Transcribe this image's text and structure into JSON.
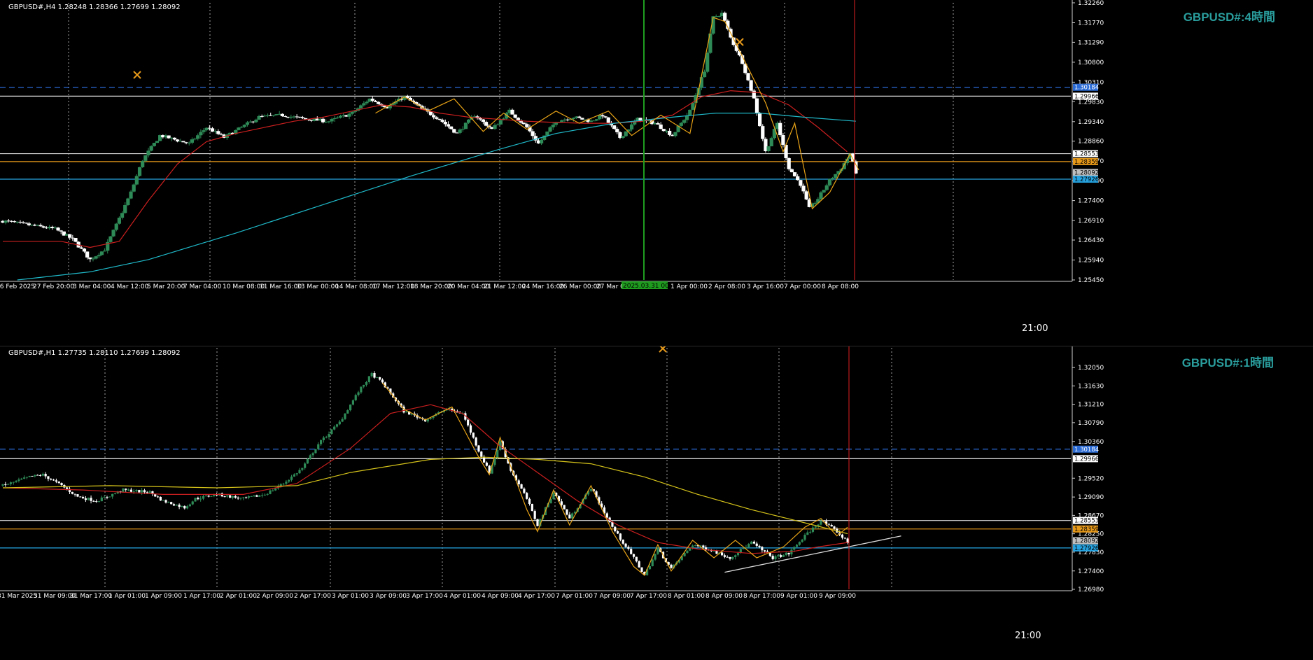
{
  "colors": {
    "background": "#000000",
    "grid": "#c8c8c8",
    "bull": "#2e8b57",
    "bear": "#ffffff",
    "ma_red": "#cc1f1f",
    "ma_cyan": "#1fb8c8",
    "ma_yellow": "#d4c21a",
    "zigzag": "#e8a317",
    "trend": "#dddddd",
    "level_blue_dash": "#2a6ad4",
    "level_white": "#e0e0e0",
    "level_orange": "#e89a1a",
    "level_cyan": "#26a3e0",
    "time_red": "#e02020",
    "vline_green": "#1f9d1f",
    "label_teal": "#2a9d9d"
  },
  "chart_data": [
    {
      "type": "candlestick",
      "symbol": "GBPUSD#,H4",
      "header": "GBPUSD#,H4  1.28248 1.28366 1.27699 1.28092",
      "ohlc": {
        "open": 1.28248,
        "high": 1.28366,
        "low": 1.27699,
        "close": 1.28092
      },
      "timeframe_label": "GBPUSD#:4時間",
      "ylim": [
        1.2545,
        1.3226
      ],
      "y_ticks": [
        "1.32260",
        "1.31770",
        "1.31290",
        "1.30800",
        "1.30310",
        "1.29830",
        "1.29340",
        "1.28860",
        "1.28370",
        "1.27890",
        "1.27400",
        "1.26910",
        "1.26430",
        "1.25940",
        "1.25450"
      ],
      "x_labels": [
        "26 Feb 2025",
        "27 Feb 20:00",
        "3 Mar 04:00",
        "4 Mar 12:00",
        "5 Mar 20:00",
        "7 Mar 04:00",
        "10 Mar 08:00",
        "11 Mar 16:00",
        "13 Mar 00:00",
        "14 Mar 08:00",
        "17 Mar 12:00",
        "18 Mar 20:00",
        "20 Mar 04:00",
        "21 Mar 12:00",
        "24 Mar 16:00",
        "26 Mar 00:00",
        "27 Mar 08:00",
        "2025.03.31 00:00",
        "1 Apr 00:00",
        "2 Apr 08:00",
        "3 Apr 16:00",
        "7 Apr 00:00",
        "8 Apr 08:00"
      ],
      "cursor_time": "21:00",
      "price_labels": [
        {
          "price": 1.30184,
          "text": "1.30184",
          "style": "blue"
        },
        {
          "price": 1.29966,
          "text": "1.29966",
          "style": "white"
        },
        {
          "price": 1.28553,
          "text": "1.28553",
          "style": "white"
        },
        {
          "price": 1.28359,
          "text": "1.28359",
          "style": "orange"
        },
        {
          "price": 1.28092,
          "text": "1.28092",
          "style": "gray"
        },
        {
          "price": 1.27926,
          "text": "1.27926",
          "style": "cyan"
        }
      ],
      "price_path": [
        [
          0,
          1.269
        ],
        [
          18,
          1.267
        ],
        [
          24,
          1.2645
        ],
        [
          30,
          1.2595
        ],
        [
          35,
          1.262
        ],
        [
          39,
          1.268
        ],
        [
          44,
          1.276
        ],
        [
          48,
          1.284
        ],
        [
          54,
          1.29
        ],
        [
          64,
          1.288
        ],
        [
          70,
          1.292
        ],
        [
          76,
          1.2895
        ],
        [
          82,
          1.292
        ],
        [
          88,
          1.2945
        ],
        [
          96,
          1.295
        ],
        [
          104,
          1.294
        ],
        [
          112,
          1.2935
        ],
        [
          120,
          1.2955
        ],
        [
          126,
          1.299
        ],
        [
          132,
          1.297
        ],
        [
          138,
          1.2995
        ],
        [
          144,
          1.2965
        ],
        [
          150,
          1.294
        ],
        [
          156,
          1.2905
        ],
        [
          162,
          1.295
        ],
        [
          168,
          1.2915
        ],
        [
          174,
          1.296
        ],
        [
          180,
          1.292
        ],
        [
          184,
          1.288
        ],
        [
          190,
          1.2935
        ],
        [
          196,
          1.2945
        ],
        [
          202,
          1.2935
        ],
        [
          206,
          1.295
        ],
        [
          212,
          1.2895
        ],
        [
          218,
          1.294
        ],
        [
          224,
          1.293
        ],
        [
          230,
          1.29
        ],
        [
          236,
          1.296
        ],
        [
          241,
          1.306
        ],
        [
          244,
          1.319
        ],
        [
          247,
          1.32
        ],
        [
          250,
          1.314
        ],
        [
          254,
          1.308
        ],
        [
          258,
          1.299
        ],
        [
          262,
          1.286
        ],
        [
          266,
          1.293
        ],
        [
          270,
          1.282
        ],
        [
          274,
          1.278
        ],
        [
          277,
          1.272
        ],
        [
          280,
          1.2745
        ],
        [
          284,
          1.279
        ],
        [
          288,
          1.282
        ],
        [
          291,
          1.2855
        ],
        [
          293,
          1.281
        ]
      ],
      "ma_red_path": [
        [
          0,
          1.264
        ],
        [
          20,
          1.264
        ],
        [
          30,
          1.2625
        ],
        [
          40,
          1.264
        ],
        [
          50,
          1.274
        ],
        [
          60,
          1.283
        ],
        [
          70,
          1.2885
        ],
        [
          80,
          1.2905
        ],
        [
          90,
          1.292
        ],
        [
          100,
          1.2935
        ],
        [
          110,
          1.2945
        ],
        [
          120,
          1.296
        ],
        [
          130,
          1.2975
        ],
        [
          140,
          1.297
        ],
        [
          150,
          1.2955
        ],
        [
          160,
          1.2945
        ],
        [
          170,
          1.294
        ],
        [
          180,
          1.2935
        ],
        [
          190,
          1.2932
        ],
        [
          200,
          1.293
        ],
        [
          210,
          1.293
        ],
        [
          220,
          1.2935
        ],
        [
          230,
          1.295
        ],
        [
          240,
          1.2995
        ],
        [
          250,
          1.301
        ],
        [
          260,
          1.3005
        ],
        [
          270,
          1.2975
        ],
        [
          280,
          1.292
        ],
        [
          290,
          1.286
        ]
      ],
      "ma_cyan_path": [
        [
          5,
          1.2545
        ],
        [
          30,
          1.2565
        ],
        [
          50,
          1.2595
        ],
        [
          80,
          1.266
        ],
        [
          110,
          1.273
        ],
        [
          140,
          1.28
        ],
        [
          170,
          1.2865
        ],
        [
          190,
          1.2905
        ],
        [
          210,
          1.293
        ],
        [
          230,
          1.2945
        ],
        [
          245,
          1.2955
        ],
        [
          260,
          1.2955
        ],
        [
          275,
          1.2945
        ],
        [
          293,
          1.2935
        ]
      ],
      "zigzag_path": [
        [
          128,
          1.2955
        ],
        [
          138,
          1.2995
        ],
        [
          146,
          1.296
        ],
        [
          155,
          1.299
        ],
        [
          165,
          1.291
        ],
        [
          172,
          1.2955
        ],
        [
          180,
          1.2915
        ],
        [
          190,
          1.296
        ],
        [
          198,
          1.293
        ],
        [
          208,
          1.296
        ],
        [
          216,
          1.29
        ],
        [
          226,
          1.295
        ],
        [
          236,
          1.2905
        ],
        [
          244,
          1.319
        ],
        [
          248,
          1.318
        ],
        [
          262,
          1.298
        ],
        [
          268,
          1.286
        ],
        [
          272,
          1.293
        ],
        [
          278,
          1.272
        ],
        [
          284,
          1.276
        ],
        [
          291,
          1.2855
        ],
        [
          294,
          1.2815
        ]
      ]
    },
    {
      "type": "candlestick",
      "symbol": "GBPUSD#,H1",
      "header": "GBPUSD#,H1  1.27735 1.28110 1.27699 1.28092",
      "ohlc": {
        "open": 1.27735,
        "high": 1.2811,
        "low": 1.27699,
        "close": 1.28092
      },
      "timeframe_label": "GBPUSD#:1時間",
      "ylim": [
        1.2698,
        1.325
      ],
      "y_ticks": [
        "1.32050",
        "1.31630",
        "1.31210",
        "1.30790",
        "1.30360",
        "1.29520",
        "1.29090",
        "1.28670",
        "1.28250",
        "1.27830",
        "1.27400",
        "1.26980"
      ],
      "x_labels": [
        "31 Mar 2025",
        "31 Mar 09:00",
        "31 Mar 17:00",
        "1 Apr 01:00",
        "1 Apr 09:00",
        "1 Apr 17:00",
        "2 Apr 01:00",
        "2 Apr 09:00",
        "2 Apr 17:00",
        "3 Apr 01:00",
        "3 Apr 09:00",
        "3 Apr 17:00",
        "4 Apr 01:00",
        "4 Apr 09:00",
        "4 Apr 17:00",
        "7 Apr 01:00",
        "7 Apr 09:00",
        "7 Apr 17:00",
        "8 Apr 01:00",
        "8 Apr 09:00",
        "8 Apr 17:00",
        "9 Apr 01:00",
        "9 Apr 09:00"
      ],
      "cursor_time": "21:00",
      "price_labels": [
        {
          "price": 1.30184,
          "text": "1.30184",
          "style": "blue"
        },
        {
          "price": 1.29966,
          "text": "1.29966",
          "style": "white"
        },
        {
          "price": 1.28553,
          "text": "1.28553",
          "style": "white"
        },
        {
          "price": 1.28359,
          "text": "1.28359",
          "style": "orange"
        },
        {
          "price": 1.28092,
          "text": "1.28092",
          "style": "gray"
        },
        {
          "price": 1.27926,
          "text": "1.27926",
          "style": "cyan"
        }
      ],
      "price_path": [
        [
          0,
          1.2935
        ],
        [
          10,
          1.2955
        ],
        [
          15,
          1.296
        ],
        [
          22,
          1.2935
        ],
        [
          28,
          1.291
        ],
        [
          35,
          1.29
        ],
        [
          45,
          1.2925
        ],
        [
          55,
          1.292
        ],
        [
          60,
          1.29
        ],
        [
          68,
          1.2885
        ],
        [
          72,
          1.2905
        ],
        [
          80,
          1.2915
        ],
        [
          90,
          1.2905
        ],
        [
          98,
          1.2915
        ],
        [
          105,
          1.294
        ],
        [
          112,
          1.2975
        ],
        [
          118,
          1.303
        ],
        [
          126,
          1.308
        ],
        [
          133,
          1.315
        ],
        [
          138,
          1.319
        ],
        [
          142,
          1.317
        ],
        [
          150,
          1.3105
        ],
        [
          158,
          1.3085
        ],
        [
          166,
          1.311
        ],
        [
          172,
          1.31
        ],
        [
          178,
          1.3015
        ],
        [
          182,
          1.2965
        ],
        [
          186,
          1.3035
        ],
        [
          190,
          1.297
        ],
        [
          196,
          1.2905
        ],
        [
          200,
          1.2845
        ],
        [
          206,
          1.292
        ],
        [
          212,
          1.286
        ],
        [
          220,
          1.293
        ],
        [
          228,
          1.284
        ],
        [
          236,
          1.277
        ],
        [
          240,
          1.273
        ],
        [
          245,
          1.279
        ],
        [
          250,
          1.2745
        ],
        [
          258,
          1.28
        ],
        [
          264,
          1.279
        ],
        [
          272,
          1.277
        ],
        [
          280,
          1.2805
        ],
        [
          288,
          1.277
        ],
        [
          294,
          1.278
        ],
        [
          300,
          1.282
        ],
        [
          306,
          1.2855
        ],
        [
          312,
          1.283
        ],
        [
          316,
          1.2805
        ]
      ],
      "ma_red_path": [
        [
          0,
          1.293
        ],
        [
          30,
          1.2925
        ],
        [
          60,
          1.2915
        ],
        [
          90,
          1.2915
        ],
        [
          110,
          1.294
        ],
        [
          130,
          1.302
        ],
        [
          145,
          1.31
        ],
        [
          160,
          1.312
        ],
        [
          172,
          1.31
        ],
        [
          185,
          1.303
        ],
        [
          200,
          1.2965
        ],
        [
          215,
          1.29
        ],
        [
          230,
          1.2845
        ],
        [
          245,
          1.2805
        ],
        [
          260,
          1.279
        ],
        [
          280,
          1.278
        ],
        [
          296,
          1.2785
        ],
        [
          305,
          1.2795
        ],
        [
          316,
          1.2805
        ]
      ],
      "ma_yellow_path": [
        [
          0,
          1.293
        ],
        [
          40,
          1.2935
        ],
        [
          80,
          1.293
        ],
        [
          110,
          1.2935
        ],
        [
          130,
          1.2965
        ],
        [
          160,
          1.2995
        ],
        [
          180,
          1.3
        ],
        [
          200,
          1.2995
        ],
        [
          220,
          1.2985
        ],
        [
          240,
          1.2955
        ],
        [
          260,
          1.2915
        ],
        [
          280,
          1.288
        ],
        [
          300,
          1.285
        ],
        [
          316,
          1.2825
        ]
      ],
      "zigzag_path": [
        [
          142,
          1.317
        ],
        [
          150,
          1.311
        ],
        [
          158,
          1.3085
        ],
        [
          168,
          1.3115
        ],
        [
          178,
          1.3
        ],
        [
          182,
          1.296
        ],
        [
          186,
          1.3045
        ],
        [
          196,
          1.288
        ],
        [
          200,
          1.283
        ],
        [
          206,
          1.2925
        ],
        [
          212,
          1.2845
        ],
        [
          220,
          1.2935
        ],
        [
          228,
          1.283
        ],
        [
          236,
          1.275
        ],
        [
          240,
          1.273
        ],
        [
          245,
          1.28
        ],
        [
          250,
          1.274
        ],
        [
          258,
          1.281
        ],
        [
          266,
          1.277
        ],
        [
          274,
          1.281
        ],
        [
          282,
          1.277
        ],
        [
          292,
          1.2795
        ],
        [
          300,
          1.284
        ],
        [
          306,
          1.286
        ],
        [
          312,
          1.282
        ],
        [
          316,
          1.284
        ]
      ],
      "trendline": [
        [
          270,
          1.2737
        ],
        [
          336,
          1.282
        ]
      ]
    }
  ]
}
